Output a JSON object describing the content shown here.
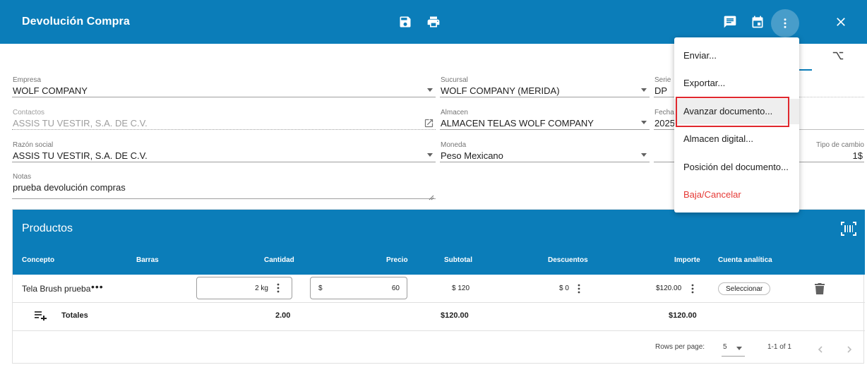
{
  "header": {
    "title": "Devolución Compra"
  },
  "icons": {
    "save": "save-icon",
    "print": "print-icon",
    "comment": "comment-icon",
    "calendar": "calendar-icon",
    "more": "more-vertical-icon",
    "close": "close-icon"
  },
  "form": {
    "empresa": {
      "label": "Empresa",
      "value": "WOLF COMPANY"
    },
    "sucursal": {
      "label": "Sucursal",
      "value": "WOLF COMPANY (MERIDA)"
    },
    "serie": {
      "label": "Serie",
      "value": "DP"
    },
    "contactos": {
      "label": "Contactos",
      "value": "ASSIS TU VESTIR, S.A. DE C.V."
    },
    "almacen": {
      "label": "Almacen",
      "value": "ALMACEN TELAS WOLF COMPANY"
    },
    "fecha": {
      "label": "Fecha",
      "value": "2025"
    },
    "razon_social": {
      "label": "Razón social",
      "value": "ASSIS TU VESTIR, S.A. DE C.V."
    },
    "moneda": {
      "label": "Moneda",
      "value": "Peso Mexicano"
    },
    "tipo_cambio": {
      "label": "Tipo de cambio",
      "value": "1$"
    },
    "notas": {
      "label": "Notas",
      "value": "prueba devolución compras"
    }
  },
  "products": {
    "title": "Productos",
    "columns": [
      "Concepto",
      "Barras",
      "Cantidad",
      "Precio",
      "Subtotal",
      "Descuentos",
      "Importe",
      "Cuenta analítica"
    ],
    "rows": [
      {
        "concepto": "Tela Brush prueba",
        "cantidad": "2 kg",
        "precio_currency": "$",
        "precio": "60",
        "subtotal": "$ 120",
        "descuentos": "$ 0",
        "importe": "$120.00",
        "cuenta_button": "Seleccionar"
      }
    ],
    "totals": {
      "label": "Totales",
      "cantidad": "2.00",
      "subtotal": "$120.00",
      "importe": "$120.00"
    },
    "pagination": {
      "rows_per_page_label": "Rows per page:",
      "rows_per_page": "5",
      "range": "1-1 of 1"
    }
  },
  "menu": {
    "items": [
      {
        "label": "Enviar..."
      },
      {
        "label": "Exportar..."
      },
      {
        "label": "Avanzar documento..."
      },
      {
        "label": "Almacen digital..."
      },
      {
        "label": "Posición del documento..."
      },
      {
        "label": "Baja/Cancelar"
      }
    ]
  },
  "colors": {
    "primary": "#0b7db9",
    "danger": "#e53935",
    "highlight": "#e0282e"
  }
}
